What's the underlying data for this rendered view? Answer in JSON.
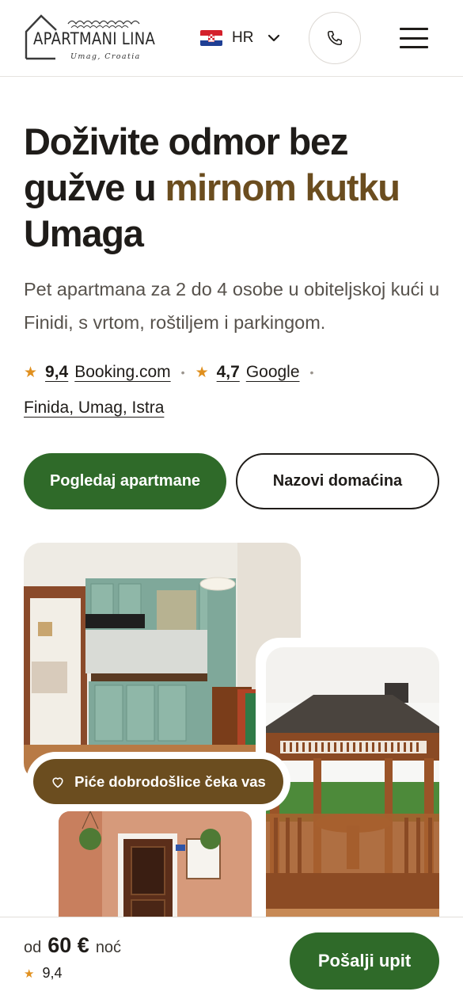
{
  "header": {
    "logo_title": "APARTMANI LINA",
    "logo_subtitle": "Umag, Croatia",
    "language": "HR",
    "flag_icon": "croatia-flag-icon",
    "phone_icon": "phone-icon",
    "menu_icon": "hamburger-menu-icon"
  },
  "hero": {
    "title_part1": "Doživite odmor bez gužve u ",
    "title_accent": "mirnom kutku",
    "title_part2": " Umaga",
    "subtitle": "Pet apartmana za 2 do 4 osobe u obiteljskoj kući u Finidi, s vrtom, roštiljem i parkingom.",
    "ratings": [
      {
        "value": "9,4",
        "source": "Booking.com"
      },
      {
        "value": "4,7",
        "source": "Google"
      }
    ],
    "location": "Finida, Umag, Istra",
    "primary_button": "Pogledaj apartmane",
    "secondary_button": "Nazovi domaćina"
  },
  "gallery": {
    "badge": "Piće dobrodošlice čeka vas",
    "badge_icon": "heart-icon"
  },
  "bottom_bar": {
    "price_from": "od",
    "price_value": "60 €",
    "price_unit": "noć",
    "rating": "9,4",
    "cta": "Pošalji upit"
  },
  "colors": {
    "accent_brown": "#6b4d1f",
    "primary_green": "#2f6a29",
    "star_orange": "#e0901f"
  }
}
